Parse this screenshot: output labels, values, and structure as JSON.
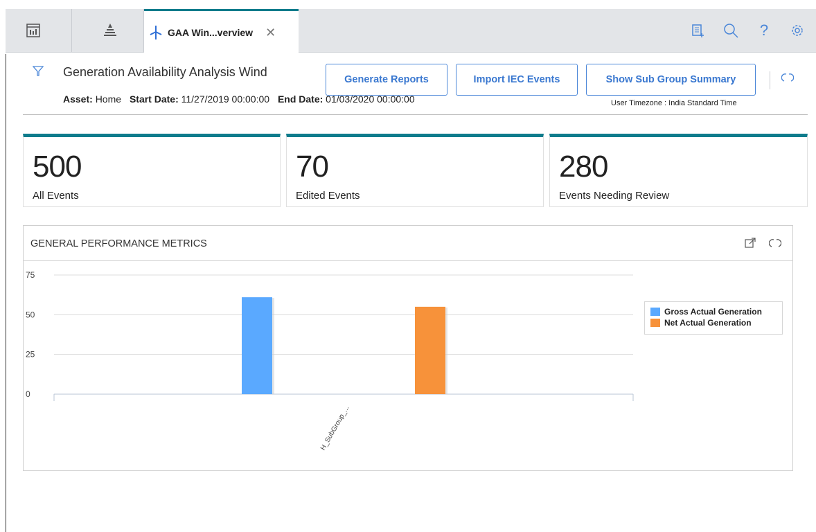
{
  "tabs": {
    "active_tab": {
      "title": "GAA Win...verview",
      "icon": "wind-turbine-icon"
    },
    "pinned": [
      {
        "icon": "dashboard-icon"
      },
      {
        "icon": "asset-hierarchy-icon"
      }
    ],
    "tools": [
      {
        "icon": "notes-icon"
      },
      {
        "icon": "search-icon"
      },
      {
        "icon": "help-icon"
      },
      {
        "icon": "settings-gear-icon"
      }
    ]
  },
  "header": {
    "title": "Generation Availability Analysis Wind",
    "asset_label": "Asset:",
    "asset_value": "Home",
    "start_label": "Start Date:",
    "start_value": "11/27/2019 00:00:00",
    "end_label": "End Date:",
    "end_value": "01/03/2020 00:00:00",
    "timezone": "User Timezone : India Standard Time",
    "buttons": {
      "generate_reports": "Generate Reports",
      "import_iec": "Import IEC Events",
      "sub_group": "Show Sub Group Summary"
    }
  },
  "kpis": [
    {
      "value": "500",
      "label": "All Events"
    },
    {
      "value": "70",
      "label": "Edited Events"
    },
    {
      "value": "280",
      "label": "Events Needing Review"
    }
  ],
  "panel": {
    "title": "GENERAL PERFORMANCE METRICS"
  },
  "colors": {
    "accent": "#0f7c8c",
    "link": "#3a78d0",
    "gross": "#5aa9ff",
    "net": "#f7923a"
  },
  "chart_data": {
    "type": "bar",
    "categories": [
      "H_SubGroup_..."
    ],
    "series": [
      {
        "name": "Gross Actual Generation",
        "values": [
          61
        ],
        "color": "#5aa9ff"
      },
      {
        "name": "Net Actual Generation",
        "values": [
          55
        ],
        "color": "#f7923a"
      }
    ],
    "yticks": [
      0,
      25,
      50,
      75
    ],
    "ylim": [
      0,
      75
    ],
    "legend": "right",
    "grid": true
  }
}
